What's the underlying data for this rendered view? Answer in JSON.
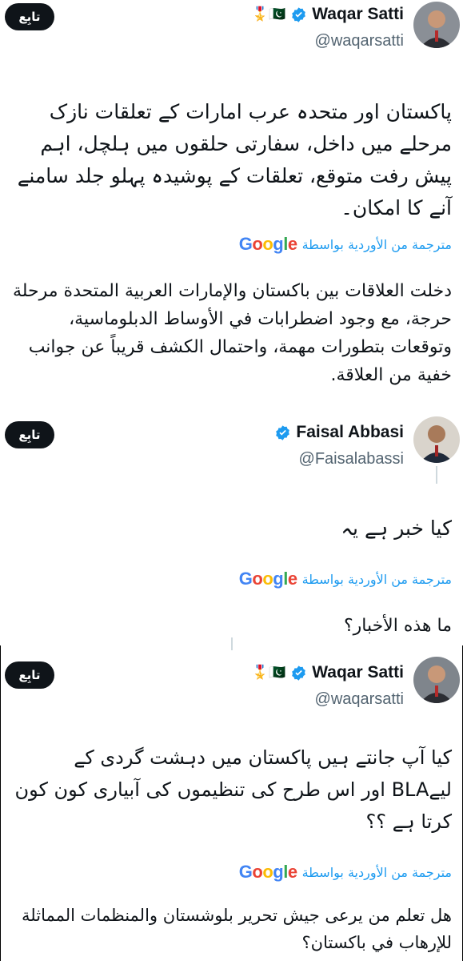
{
  "tweets": [
    {
      "follow_label": "تابِع",
      "name": "Waqar Satti",
      "handle": "@waqarsatti",
      "flags": "🎖️🇵🇰",
      "body": "پاکستان اور متحدہ عرب امارات کے تعلقات نازک مرحلے میں داخل، سفارتی حلقوں میں ہلچل، اہم پیش رفت متوقع، تعلقات کے پوشیدہ پہلو جلد سامنے آنے کا امکان۔",
      "translated_by": "مترجمة من الأوردية بواسطة",
      "translation": "دخلت العلاقات بين باكستان والإمارات العربية المتحدة مرحلة حرجة، مع وجود اضطرابات في الأوساط الدبلوماسية، وتوقعات بتطورات مهمة، واحتمال الكشف قريباً عن جوانب خفية من العلاقة."
    },
    {
      "follow_label": "تابِع",
      "name": "Faisal Abbasi",
      "handle": "@Faisalabassi",
      "body": "کیا خبر ہے یہ",
      "translated_by": "مترجمة من الأوردية بواسطة",
      "translation": "ما هذه الأخبار؟"
    },
    {
      "follow_label": "تابِع",
      "name": "Waqar Satti",
      "handle": "@waqarsatti",
      "flags": "🎖️🇵🇰",
      "body": "کیا آپ جانتے ہیں پاکستان میں دہشت گردی کے لیےBLA اور اس طرح کی تنظیموں کی آبیاری کون کون کرتا ہے ؟؟",
      "translated_by": "مترجمة من الأوردية بواسطة",
      "translation": "هل تعلم من يرعى جيش تحرير بلوشستان والمنظمات المماثلة للإرهاب في باكستان؟"
    }
  ],
  "google_logo": "Google",
  "colors": {
    "link": "#1d9bf0",
    "verified": "#1d9bf0",
    "text": "#0f1419",
    "secondary": "#536471"
  }
}
